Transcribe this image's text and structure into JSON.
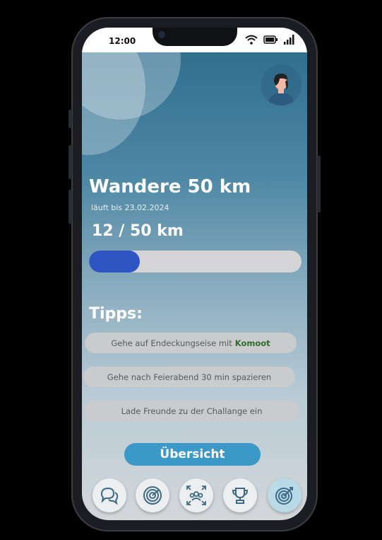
{
  "status": {
    "time": "12:00",
    "icons": [
      "wifi-icon",
      "battery-icon",
      "signal-icon"
    ]
  },
  "challenge": {
    "title": "Wandere 50 km",
    "subtitle": "läuft bis 23.02.2024",
    "progress_text": "12 / 50 km",
    "progress_fraction": 0.24
  },
  "tips": {
    "heading": "Tipps:",
    "items": [
      {
        "text": "Gehe auf Endeckungseise mit",
        "highlight": "Komoot"
      },
      {
        "text": "Gehe nach Feierabend 30 min spazieren",
        "highlight": ""
      },
      {
        "text": "Lade Freunde zu der Challange ein",
        "highlight": ""
      }
    ]
  },
  "overview_button": {
    "label": "Übersicht"
  },
  "bottom_nav": [
    {
      "icon": "chat-icon",
      "active": false
    },
    {
      "icon": "radar-icon",
      "active": false
    },
    {
      "icon": "group-icon",
      "active": false
    },
    {
      "icon": "trophy-icon",
      "active": false
    },
    {
      "icon": "target-icon",
      "active": true
    }
  ],
  "colors": {
    "accent": "#3b98c7",
    "progress": "#2f55c4",
    "highlight": "#2f6a2f"
  }
}
